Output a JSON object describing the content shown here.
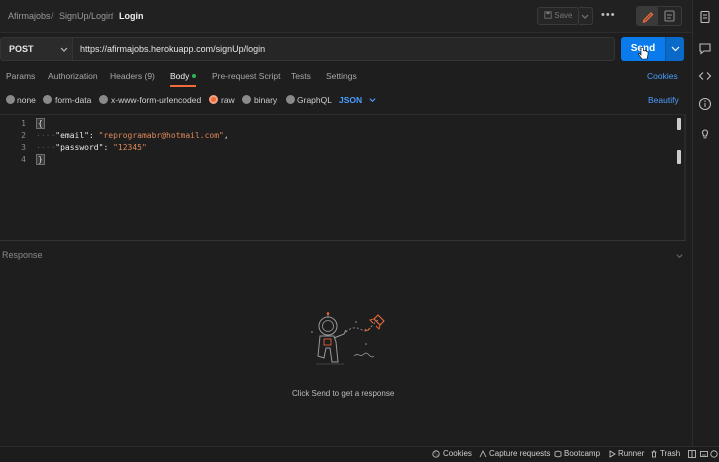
{
  "breadcrumb": {
    "workspace": "Afirmajobs",
    "sep1": "/",
    "folder": "SignUp/Login",
    "sep2": "/",
    "request": "Login"
  },
  "toolbar": {
    "save_label": "Save",
    "more_label": "•••"
  },
  "request": {
    "method": "POST",
    "url": "https://afirmajobs.herokuapp.com/signUp/login",
    "send_label": "Send"
  },
  "tabs": {
    "params": "Params",
    "authorization": "Authorization",
    "headers": "Headers (9)",
    "body": "Body",
    "prerequest": "Pre-request Script",
    "tests": "Tests",
    "settings": "Settings",
    "cookies": "Cookies"
  },
  "body_types": {
    "none": "none",
    "form_data": "form-data",
    "urlencoded": "x-www-form-urlencoded",
    "raw": "raw",
    "binary": "binary",
    "graphql": "GraphQL",
    "format": "JSON",
    "beautify": "Beautify"
  },
  "editor": {
    "lines": [
      "1",
      "2",
      "3",
      "4"
    ],
    "open_brace": "{",
    "close_brace": "}",
    "indent": "····",
    "email_key": "\"email\"",
    "email_val": "\"reprogramabr@hotmail.com\"",
    "password_key": "\"password\"",
    "password_val": "\"12345\"",
    "colon": ": ",
    "comma": ","
  },
  "response": {
    "title": "Response",
    "hint": "Click Send to get a response"
  },
  "statusbar": {
    "cookies": "Cookies",
    "capture": "Capture requests",
    "bootcamp": "Bootcamp",
    "runner": "Runner",
    "trash": "Trash"
  },
  "colors": {
    "accent": "#097bed",
    "active_tab": "#f26b3a",
    "link": "#4a9eff",
    "string": "#e0895a"
  },
  "icons": [
    "floppy-icon",
    "chevron-down-icon",
    "pencil-icon",
    "document-icon",
    "code-icon",
    "info-icon",
    "lightbulb-icon",
    "cookie-icon",
    "capture-icon",
    "bootcamp-icon",
    "runner-icon",
    "trash-icon",
    "layout-icon",
    "keyboard-icon",
    "help-icon"
  ]
}
